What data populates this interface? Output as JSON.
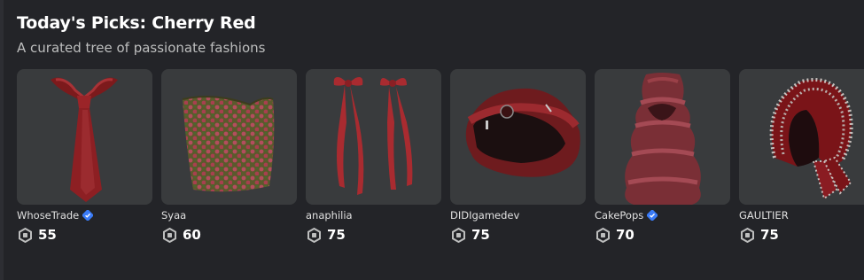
{
  "section": {
    "title": "Today's Picks: Cherry Red",
    "subtitle": "A curated tree of passionate fashions"
  },
  "items": [
    {
      "icon": "red-tie",
      "creator": "WhoseTrade",
      "verified": true,
      "price": "55"
    },
    {
      "icon": "rose-tube-top",
      "creator": "Syaa",
      "verified": false,
      "price": "60"
    },
    {
      "icon": "red-ribbon-bows",
      "creator": "anaphilia",
      "verified": false,
      "price": "75"
    },
    {
      "icon": "red-cap-hat",
      "creator": "DIDIgamedev",
      "verified": false,
      "price": "75"
    },
    {
      "icon": "ruffle-dress",
      "creator": "CakePops",
      "verified": true,
      "price": "70"
    },
    {
      "icon": "studded-hood",
      "creator": "GAULTIER",
      "verified": false,
      "price": "75"
    }
  ],
  "colors": {
    "background": "#232428",
    "card": "#393b3d",
    "verified_badge": "#3a7bf7"
  }
}
